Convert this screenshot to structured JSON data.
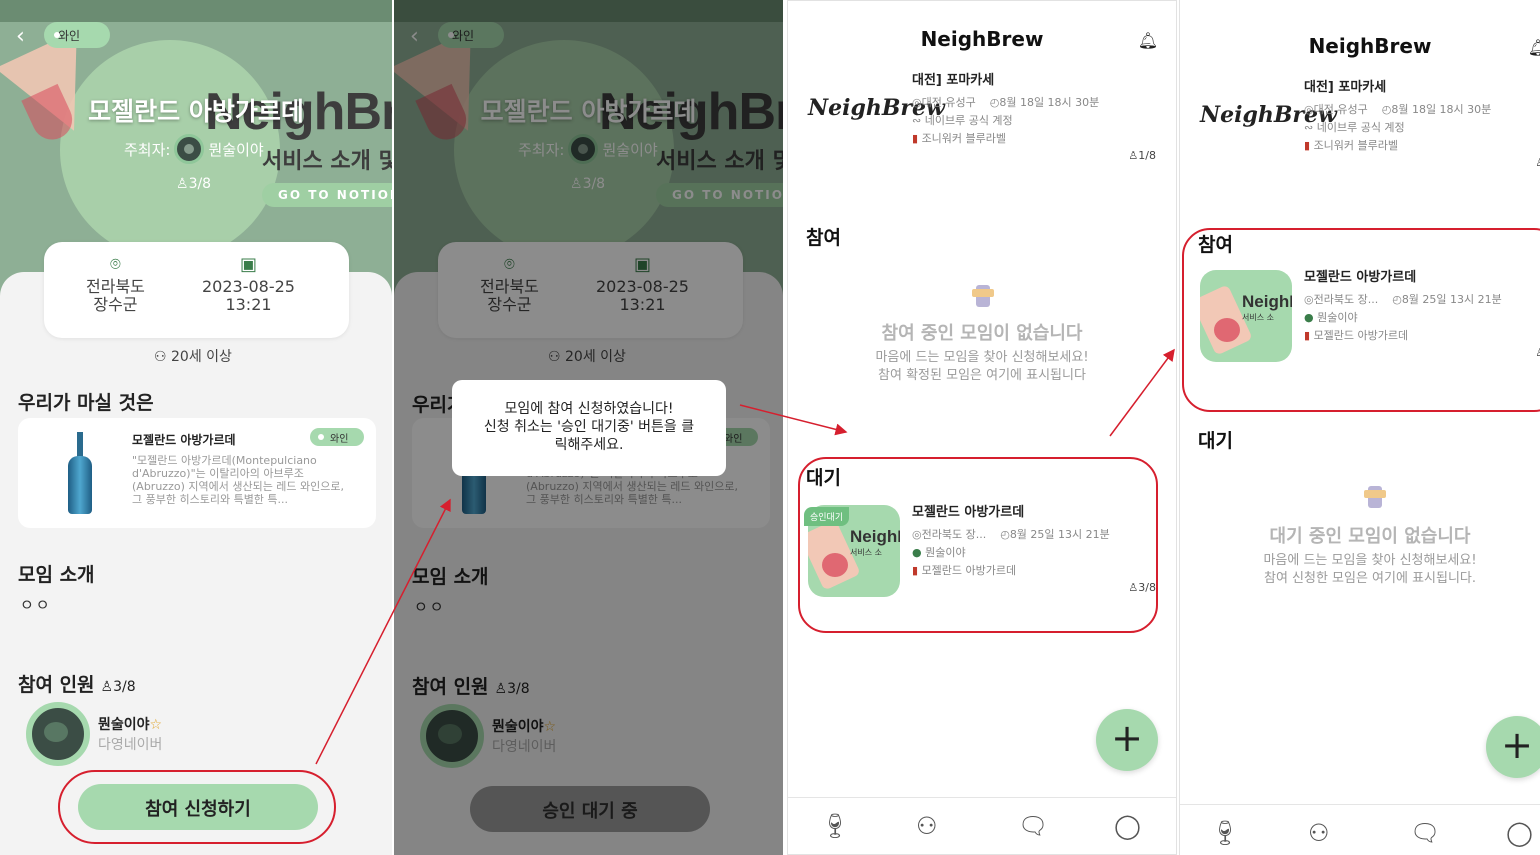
{
  "detail": {
    "chip": "와인",
    "title": "모젤란드 아방가르데",
    "host_label": "주최자:",
    "host_name": "뭔술이야",
    "count": "3/8",
    "hero_brand": "NeighBr",
    "hero_service": "서비스 소개 및",
    "hero_notion": "GO TO NOTION",
    "region_line1": "전라북도",
    "region_line2": "장수군",
    "date": "2023-08-25",
    "time": "13:21",
    "age": "20세 이상",
    "drink_heading": "우리가 마실 것은",
    "wine_name": "모젤란드 아방가르데",
    "wine_chip": "와인",
    "wine_desc": "\"모젤란드 아방가르데(Montepulciano d'Abruzzo)\"는 이탈리아의 아브루조(Abruzzo) 지역에서 생산되는 레드 와인으로, 그 풍부한 히스토리와 특별한 특...",
    "intro_heading": "모임 소개",
    "intro_text": "ㅇㅇ",
    "members_heading": "참여 인원",
    "members_count": "3/8",
    "member_name": "뭔술이야",
    "member_sub": "다영네이버",
    "apply_button": "참여 신청하기",
    "wait_button": "승인 대기 중",
    "dialog_line1": "모임에 참여 신청하였습니다!",
    "dialog_line2": "신청 취소는 '승인 대기중' 버튼을 클",
    "dialog_line3": "릭해주세요.",
    "partial_heading": "우리가"
  },
  "list": {
    "app_name": "NeighBrew",
    "logo_text": "NeighBrew",
    "top_card": {
      "title": "대전] 포마카세",
      "place": "대전 유성구",
      "time": "8월 18일 18시 30분",
      "host": "네이브루 공식 계정",
      "drink": "조니워커 블루라벨",
      "count": "1/8"
    },
    "join_heading": "참여",
    "wait_heading": "대기",
    "empty_join_title": "참여 중인 모임이 없습니다",
    "empty_join_sub1": "마음에 드는 모임을 찾아 신청해보세요!",
    "empty_join_sub2": "참여 확정된 모임은 여기에 표시됩니다",
    "empty_wait_title": "대기 중인 모임이 없습니다",
    "empty_wait_sub1": "마음에 드는 모임을 찾아 신청해보세요!",
    "empty_wait_sub2": "참여 신청한 모임은 여기에 표시됩니다.",
    "meet_card": {
      "badge": "승인대기",
      "title": "모젤란드 아방가르데",
      "place": "전라북도 장...",
      "time": "8월 25일 13시 21분",
      "host": "뭔술이야",
      "drink": "모젤란드 아방가르데",
      "count": "3/8",
      "count_cropped": "4/",
      "thumb_brand": "NeighB",
      "thumb_service": "서비스 소"
    },
    "top_card_count_cropped": "1/",
    "fab": "+"
  },
  "icons": {
    "back": "chevron-left-icon",
    "bell": "bell-icon",
    "location": "location-pin-icon",
    "calendar": "calendar-check-icon",
    "people": "person-icon",
    "wine_tab": "wine-glasses-icon",
    "group_tab": "group-icon",
    "chat_tab": "chat-icon",
    "profile_tab": "profile-icon"
  },
  "colors": {
    "accent_green": "#a6d9ae",
    "annotation_red": "#d61f2e"
  }
}
